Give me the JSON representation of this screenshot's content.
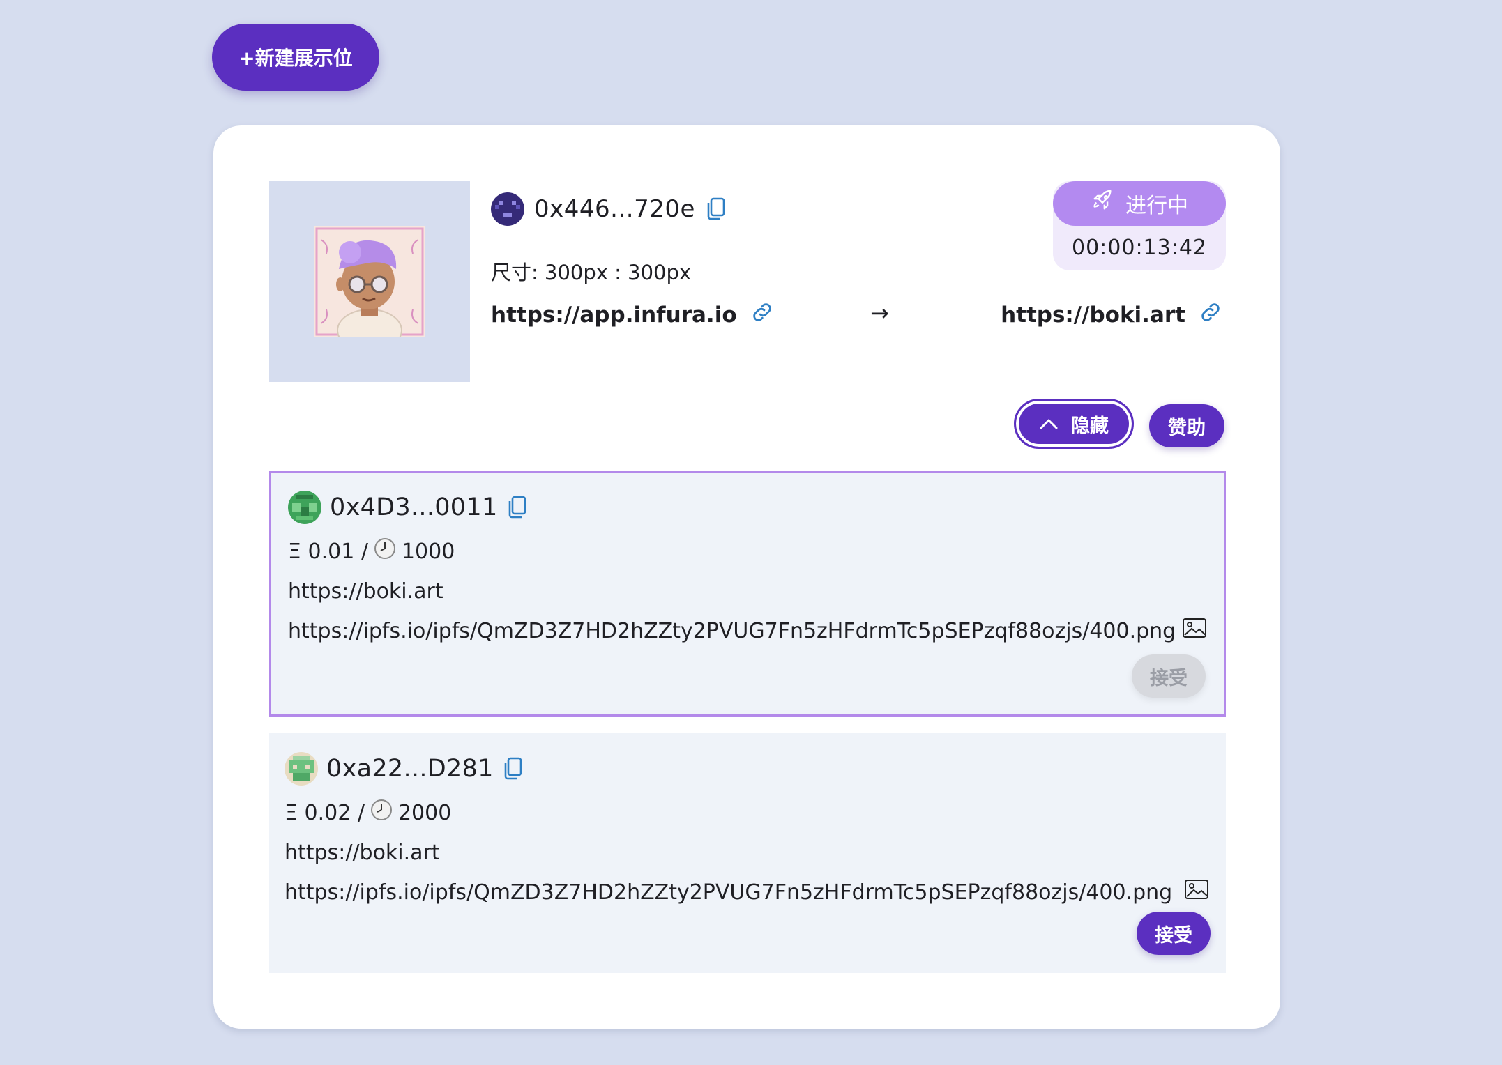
{
  "toolbar": {
    "new_label": "+新建展示位"
  },
  "slot": {
    "owner": "0x446...720e",
    "size_text": "尺寸: 300px : 300px",
    "from_url": "https://app.infura.io",
    "arrow": "→",
    "to_url": "https://boki.art",
    "status": "进行中",
    "timer": "00:00:13:42",
    "hide_label": "隐藏",
    "sponsor_label": "赞助"
  },
  "bids": [
    {
      "address": "0x4D3...0011",
      "price_prefix": "Ξ 0.01 /",
      "duration": "1000",
      "link": "https://boki.art",
      "image_url": "https://ipfs.io/ipfs/QmZD3Z7HD2hZZty2PVUG7Fn5zHFdrmTc5pSEPzqf88ozjs/400.png",
      "accept_label": "接受",
      "accept_enabled": false,
      "selected": true
    },
    {
      "address": "0xa22...D281",
      "price_prefix": "Ξ 0.02 /",
      "duration": "2000",
      "link": "https://boki.art",
      "image_url": "https://ipfs.io/ipfs/QmZD3Z7HD2hZZty2PVUG7Fn5zHFdrmTc5pSEPzqf88ozjs/400.png",
      "accept_label": "接受",
      "accept_enabled": true,
      "selected": false
    }
  ],
  "icons": {
    "copy": "copy-icon",
    "link": "link-icon",
    "rocket": "rocket-icon",
    "chevron": "chevron-up-icon",
    "clock": "clock-icon",
    "image": "image-icon"
  },
  "colors": {
    "background": "#d6ddef",
    "primary": "#5b2fc0",
    "status": "#b38af0",
    "selected_border": "#b389ea",
    "link_icon": "#2e7fc4"
  }
}
